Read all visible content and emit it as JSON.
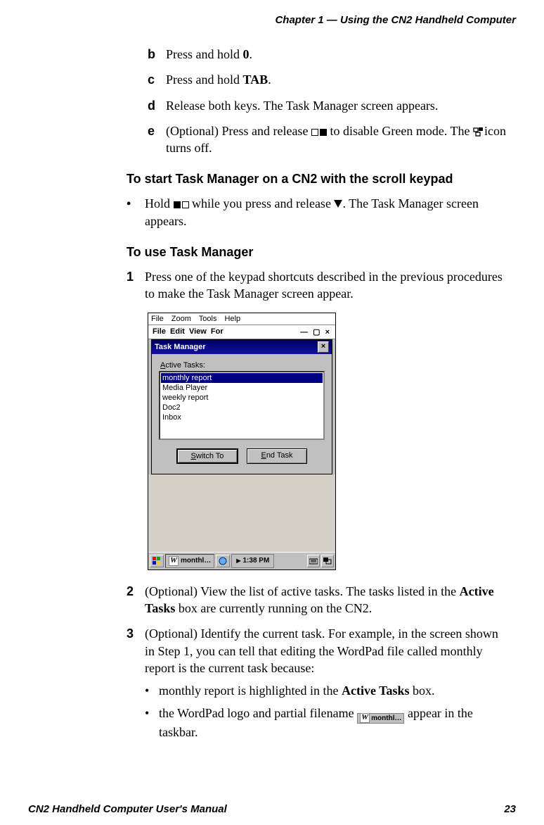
{
  "header": {
    "chapter": "Chapter 1 — Using the CN2 Handheld Computer"
  },
  "steps_abc": {
    "b": {
      "marker": "b",
      "text_pre": "Press and hold ",
      "key": "0",
      "text_post": "."
    },
    "c": {
      "marker": "c",
      "text_pre": "Press and hold ",
      "key": "TAB",
      "text_post": "."
    },
    "d": {
      "marker": "d",
      "text": "Release both keys. The Task Manager screen appears."
    },
    "e": {
      "marker": "e",
      "text_pre": "(Optional) Press and release ",
      "text_mid": " to disable Green mode. The ",
      "text_post": "icon turns off."
    }
  },
  "heading_scroll": "To start Task Manager on a CN2 with the scroll keypad",
  "bullet_scroll": {
    "pre": "Hold ",
    "mid": " while you press and release ",
    "post": ". The Task Manager screen appears."
  },
  "heading_use": "To use Task Manager",
  "steps_num": {
    "s1": {
      "marker": "1",
      "text": "Press one of the keypad shortcuts described in the previous procedures to make the Task Manager screen appear."
    },
    "s2": {
      "marker": "2",
      "pre": "(Optional) View the list of active tasks. The tasks listed in the ",
      "bold": "Active Tasks",
      "post": " box are currently running on the CN2."
    },
    "s3": {
      "marker": "3",
      "text": "(Optional) Identify the current task. For example, in the screen shown in Step 1, you can tell that editing the WordPad file called monthly report is the current task because:"
    },
    "s3_sub1": {
      "pre": "monthly report is highlighted in the ",
      "bold": "Active Tasks",
      "post": " box."
    },
    "s3_sub2": {
      "pre": "the WordPad logo and partial filename ",
      "snippet": "monthl…",
      "post": "appear in the taskbar."
    }
  },
  "tm": {
    "menu": [
      "File",
      "Zoom",
      "Tools",
      "Help"
    ],
    "title": "Task Manager",
    "label": "Active Tasks:",
    "tasks": [
      "monthly report",
      "Media Player",
      "weekly report",
      "Doc2",
      "Inbox"
    ],
    "buttons": {
      "switch": "Switch To",
      "end": "End Task"
    },
    "taskbar": {
      "task": "monthl…",
      "time": "1:38 PM"
    }
  },
  "footer": {
    "left": "CN2 Handheld Computer User's Manual",
    "right": "23"
  }
}
